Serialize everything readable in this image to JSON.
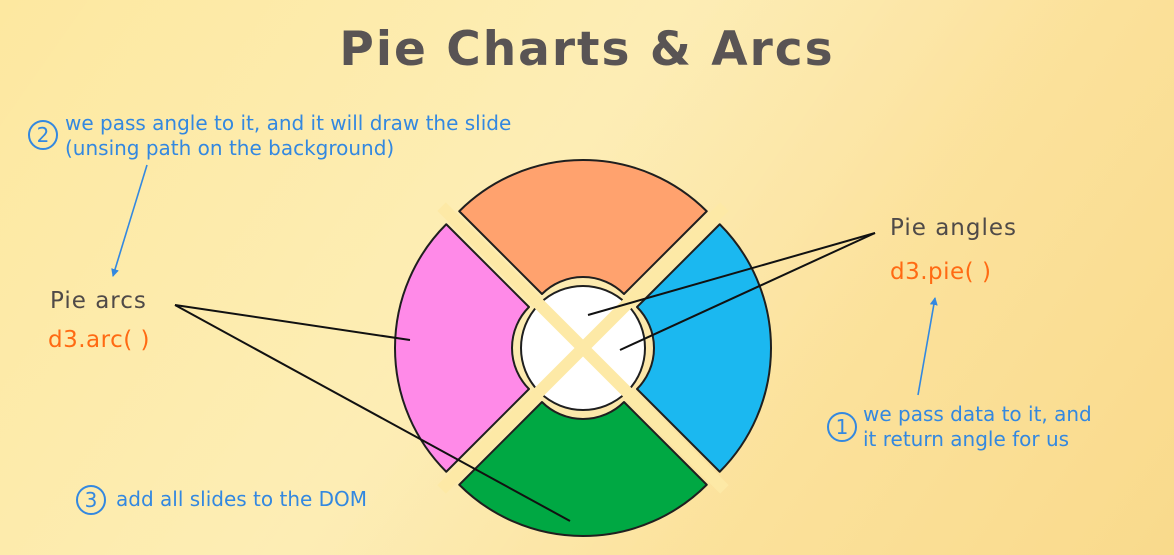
{
  "title": "Pie Charts & Arcs",
  "left_label": {
    "name": "Pie arcs",
    "code": "d3.arc( )"
  },
  "right_label": {
    "name": "Pie angles",
    "code": "d3.pie( )"
  },
  "steps": [
    {
      "number": "1",
      "lines": [
        "we pass data to it, and",
        "it return angle for us"
      ]
    },
    {
      "number": "2",
      "lines": [
        "we pass angle to it, and it will draw the slide",
        "(unsing path on the background)"
      ]
    },
    {
      "number": "3",
      "lines": [
        "add all slides to the DOM"
      ]
    }
  ],
  "colors": {
    "annotation_blue": "#3388e0",
    "code_orange": "#ff6a13",
    "slice_top": "#ffa26e",
    "slice_right": "#1bb8f0",
    "slice_bottom": "#00a843",
    "slice_left": "#ff8ae8",
    "slice_stroke": "#1f1f1f"
  }
}
